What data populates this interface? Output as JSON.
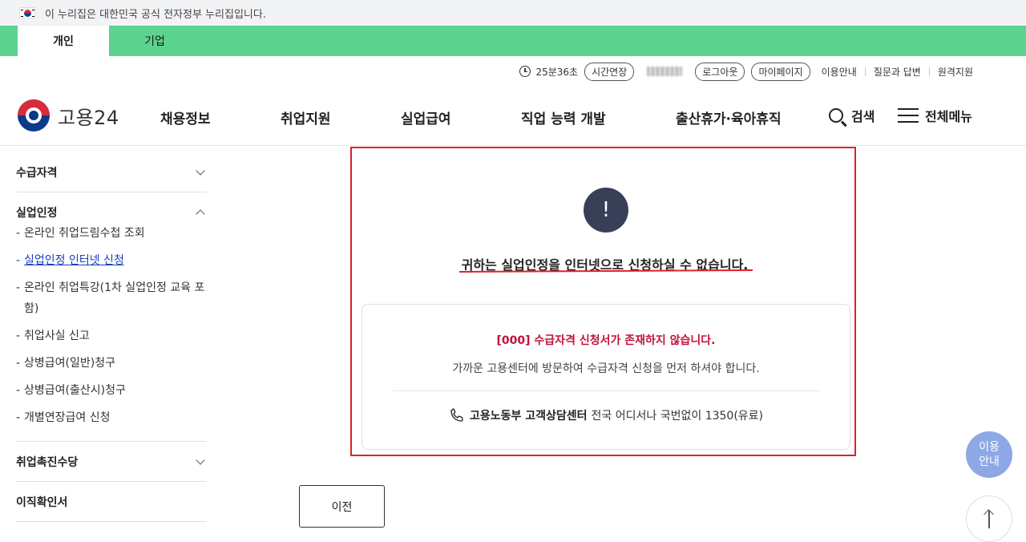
{
  "gov_banner": {
    "text": "이 누리집은 대한민국 공식 전자정부 누리집입니다."
  },
  "user_tabs": [
    {
      "label": "개인"
    },
    {
      "label": "기업"
    }
  ],
  "util_bar": {
    "session_timer": "25분36초",
    "extend_label": "시간연장",
    "logout_label": "로그아웃",
    "mypage_label": "마이페이지",
    "links": [
      "이용안내",
      "질문과 답변",
      "원격지원"
    ]
  },
  "header": {
    "logo_text": "고용24",
    "nav_items": [
      "채용정보",
      "취업지원",
      "실업급여",
      "직업 능력 개발",
      "출산휴가·육아휴직"
    ],
    "search_label": "검색",
    "menu_label": "전체메뉴"
  },
  "sidebar": {
    "group1": "수급자격",
    "group2": "실업인정",
    "group2_items": [
      "온라인 취업드림수첩 조회",
      "실업인정 인터넷 신청",
      "온라인 취업특강(1차 실업인정 교육 포함)",
      "취업사실 신고",
      "상병급여(일반)청구",
      "상병급여(출산시)청구",
      "개별연장급여 신청"
    ],
    "group3": "취업촉진수당",
    "group4": "이직확인서"
  },
  "alert": {
    "icon": "!",
    "title": "귀하는 실업인정을 인터넷으로 신청하실 수 없습니다.",
    "error_message": "[000] 수급자격 신청서가 존재하지 않습니다.",
    "description": "가까운 고용센터에 방문하여 수급자격 신청을 먼저 하셔야 합니다.",
    "contact_label": "고용노동부 고객상담센터",
    "contact_detail": "전국 어디서나 국번없이 1350(유료)"
  },
  "prev_button": "이전",
  "help_button": {
    "line1": "이용",
    "line2": "안내"
  },
  "colors": {
    "tab_green": "#5cd38e",
    "alert_border": "#e0202a",
    "error_text": "#c1123d",
    "help_bg": "#8ea8e6"
  }
}
